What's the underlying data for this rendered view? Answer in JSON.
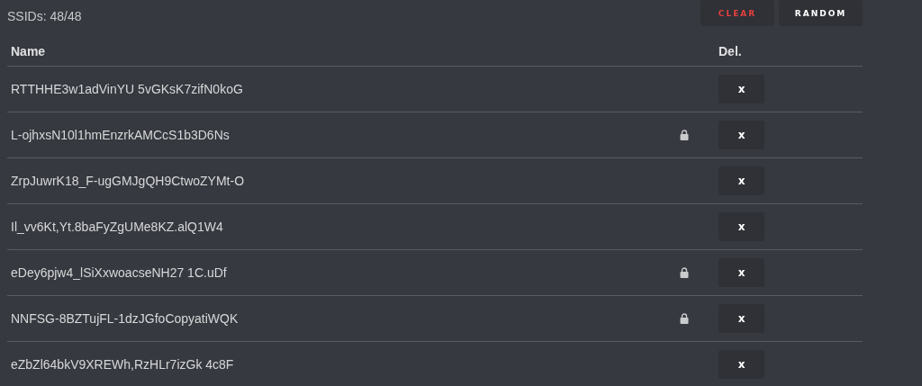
{
  "counter": "SSIDs: 48/48",
  "buttons": [
    {
      "kind": "clear",
      "label": "CLEAR"
    },
    {
      "kind": "random",
      "label": "RANDOM"
    }
  ],
  "columns": [
    "Name",
    "Del."
  ],
  "rows": [
    {
      "name": "RTTHHE3w1adVinYU 5vGKsK7zifN0koG",
      "locked": false,
      "delete": "x"
    },
    {
      "name": "L-ojhxsN10l1hmEnzrkAMCcS1b3D6Ns",
      "locked": true,
      "delete": "x"
    },
    {
      "name": "ZrpJuwrK18_F-ugGMJgQH9CtwoZYMt-O",
      "locked": false,
      "delete": "x"
    },
    {
      "name": "Il_vv6Kt,Yt.8baFyZgUMe8KZ.alQ1W4",
      "locked": false,
      "delete": "x"
    },
    {
      "name": "eDey6pjw4_lSiXxwoacseNH27 1C.uDf",
      "locked": true,
      "delete": "x"
    },
    {
      "name": "NNFSG-8BZTujFL-1dzJGfoCopyatiWQK",
      "locked": true,
      "delete": "x"
    },
    {
      "name": "eZbZl64bkV9XREWh,RzHLr7izGk 4c8F",
      "locked": false,
      "delete": "x"
    }
  ]
}
